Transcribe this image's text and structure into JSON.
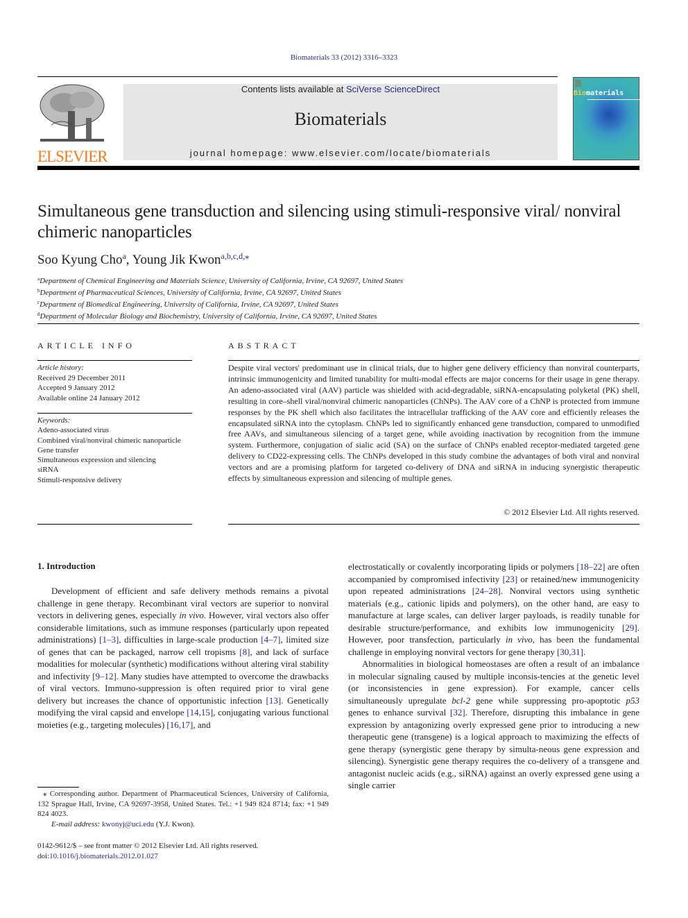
{
  "header": {
    "citation": "Biomaterials 33 (2012) 3316–3323",
    "contents_prefix": "Contents lists available at ",
    "contents_link": "SciVerse ScienceDirect",
    "journal_title": "Biomaterials",
    "homepage_prefix": "journal homepage: ",
    "homepage_url": "www.elsevier.com/locate/biomaterials",
    "publisher_logo_text": "ELSEVIER",
    "cover_title_bio": "Bio",
    "cover_title_rest": "materials"
  },
  "article": {
    "title": "Simultaneous gene transduction and silencing using stimuli-responsive viral/ nonviral chimeric nanoparticles",
    "authors": [
      {
        "name": "Soo Kyung Cho",
        "sup": "a"
      },
      {
        "name": "Young Jik Kwon",
        "sup": "a,b,c,d,⁎"
      }
    ],
    "author_separator": ", ",
    "affiliations": [
      {
        "sup": "a",
        "text": "Department of Chemical Engineering and Materials Science, University of California, Irvine, CA 92697, United States"
      },
      {
        "sup": "b",
        "text": "Department of Pharmaceutical Sciences, University of California, Irvine, CA 92697, United States"
      },
      {
        "sup": "c",
        "text": "Department of Biomedical Engineering, University of California, Irvine, CA 92697, United States"
      },
      {
        "sup": "d",
        "text": "Department of Molecular Biology and Biochemistry, University of California, Irvine, CA 92697, United States"
      }
    ]
  },
  "article_info": {
    "heading": "ARTICLE INFO",
    "history_label": "Article history:",
    "history": [
      "Received 29 December 2011",
      "Accepted 9 January 2012",
      "Available online 24 January 2012"
    ],
    "keywords_label": "Keywords:",
    "keywords": [
      "Adeno-associated virus",
      "Combined viral/nonviral chimeric nanoparticle",
      "Gene transfer",
      "Simultaneous expression and silencing",
      "siRNA",
      "Stimuli-responsive delivery"
    ]
  },
  "abstract": {
    "heading": "ABSTRACT",
    "text": "Despite viral vectors' predominant use in clinical trials, due to higher gene delivery efficiency than nonviral counterparts, intrinsic immunogenicity and limited tunability for multi-modal effects are major concerns for their usage in gene therapy. An adeno-associated viral (AAV) particle was shielded with acid-degradable, siRNA-encapsulating polyketal (PK) shell, resulting in core–shell viral/nonviral chimeric nanoparticles (ChNPs). The AAV core of a ChNP is protected from immune responses by the PK shell which also facilitates the intracellular trafficking of the AAV core and efficiently releases the encapsulated siRNA into the cytoplasm. ChNPs led to significantly enhanced gene transduction, compared to unmodified free AAVs, and simultaneous silencing of a target gene, while avoiding inactivation by recognition from the immune system. Furthermore, conjugation of sialic acid (SA) on the surface of ChNPs enabled receptor-mediated targeted gene delivery to CD22-expressing cells. The ChNPs developed in this study combine the advantages of both viral and nonviral vectors and are a promising platform for targeted co-delivery of DNA and siRNA in inducing synergistic therapeutic effects by simultaneous expression and silencing of multiple genes.",
    "copyright": "© 2012 Elsevier Ltd. All rights reserved."
  },
  "introduction": {
    "heading": "1.  Introduction",
    "left_paragraph": [
      {
        "t": "Development of efficient and safe delivery methods remains a pivotal challenge in gene therapy. Recombinant viral vectors are superior to nonviral vectors in delivering genes, especially "
      },
      {
        "i": "in vivo"
      },
      {
        "t": ". However, viral vectors also offer considerable limitations, such as immune responses (particularly upon repeated administrations) "
      },
      {
        "r": "[1–3]"
      },
      {
        "t": ", difficulties in large-scale production "
      },
      {
        "r": "[4–7]"
      },
      {
        "t": ", limited size of genes that can be packaged, narrow cell tropisms "
      },
      {
        "r": "[8]"
      },
      {
        "t": ", and lack of surface modalities for molecular (synthetic) modifications without altering viral stability and infectivity "
      },
      {
        "r": "[9–12]"
      },
      {
        "t": ". Many studies have attempted to overcome the drawbacks of viral vectors. Immuno-suppression is often required prior to viral gene delivery but increases the chance of opportunistic infection "
      },
      {
        "r": "[13]"
      },
      {
        "t": ". Genetically modifying the viral capsid and envelope "
      },
      {
        "r": "[14,15]"
      },
      {
        "t": ", conjugating various functional moieties (e.g., targeting molecules) "
      },
      {
        "r": "[16,17]"
      },
      {
        "t": ", and"
      }
    ],
    "right_paragraph_1": [
      {
        "t": "electrostatically or covalently incorporating lipids or polymers "
      },
      {
        "r": "[18–22]"
      },
      {
        "t": " are often accompanied by compromised infectivity "
      },
      {
        "r": "[23]"
      },
      {
        "t": " or retained/new immunogenicity upon repeated administrations "
      },
      {
        "r": "[24–28]"
      },
      {
        "t": ". Nonviral vectors using synthetic materials (e.g., cationic lipids and polymers), on the other hand, are easy to manufacture at large scales, can deliver larger payloads, is readily tunable for desirable structure/performance, and exhibits low immunogenicity "
      },
      {
        "r": "[29]"
      },
      {
        "t": ". However, poor transfection, particularly "
      },
      {
        "i": "in vivo"
      },
      {
        "t": ", has been the fundamental challenge in employing nonviral vectors for gene therapy "
      },
      {
        "r": "[30,31]"
      },
      {
        "t": "."
      }
    ],
    "right_paragraph_2": [
      {
        "t": "Abnormalities in biological homeostases are often a result of an imbalance in molecular signaling caused by multiple inconsis-tencies at the genetic level (or inconsistencies in gene expression). For example, cancer cells simultaneously upregulate "
      },
      {
        "i": "bcl-2"
      },
      {
        "t": " gene while suppressing pro-apoptotic "
      },
      {
        "i": "p53"
      },
      {
        "t": " genes to enhance survival "
      },
      {
        "r": "[32]"
      },
      {
        "t": ". Therefore, disrupting this imbalance in gene expression by antagonizing overly expressed gene prior to introducing a new therapeutic gene (transgene) is a logical approach to maximizing the effects of gene therapy (synergistic gene therapy by simulta-neous gene expression and silencing). Synergistic gene therapy requires the co-delivery of a transgene and antagonist nucleic acids (e.g., siRNA) against an overly expressed gene using a single carrier"
      }
    ]
  },
  "footnote": {
    "corresponding": "⁎ Corresponding author. Department of Pharmaceutical Sciences, University of California, 132 Sprague Hall, Irvine, CA 92697-3958, United States. Tel.: +1 949 824 8714; fax: +1 949 824 4023.",
    "email_label": "E-mail address: ",
    "email": "kwonyj@uci.edu",
    "email_suffix": " (Y.J. Kwon).",
    "issn_line": "0142-9612/$ – see front matter © 2012 Elsevier Ltd. All rights reserved.",
    "doi_prefix": "doi:",
    "doi": "10.1016/j.biomaterials.2012.01.027"
  },
  "colors": {
    "link": "#2b2b8f",
    "elsevier_orange": "#f47b20",
    "banner_gray": "#e6e6e6"
  }
}
